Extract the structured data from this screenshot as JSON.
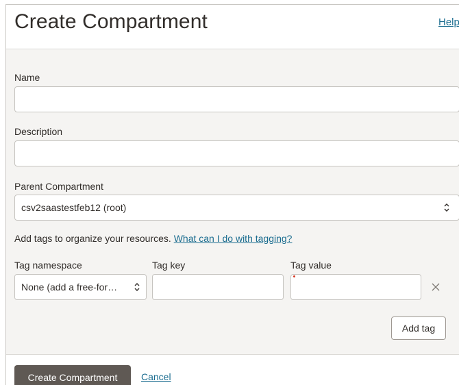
{
  "dialog": {
    "title": "Create Compartment",
    "help_link": "Help"
  },
  "form": {
    "name": {
      "label": "Name",
      "value": ""
    },
    "description": {
      "label": "Description",
      "value": ""
    },
    "parent_compartment": {
      "label": "Parent Compartment",
      "selected": "csv2saastestfeb12 (root)"
    },
    "tags": {
      "intro_text": "Add tags to organize your resources.",
      "help_link": "What can I do with tagging?",
      "namespace_label": "Tag namespace",
      "key_label": "Tag key",
      "value_label": "Tag value",
      "namespace_selected": "None (add a free-for…",
      "key_value": "",
      "value_value": "",
      "add_tag_label": "Add tag"
    }
  },
  "footer": {
    "primary_label": "Create Compartment",
    "cancel_label": "Cancel"
  },
  "icons": {
    "select_caret": "chevron-up-down-icon",
    "remove_tag": "close-icon"
  },
  "colors": {
    "link": "#1a6c8f",
    "primary_button": "#5f5954",
    "required_marker": "#d63b25"
  }
}
